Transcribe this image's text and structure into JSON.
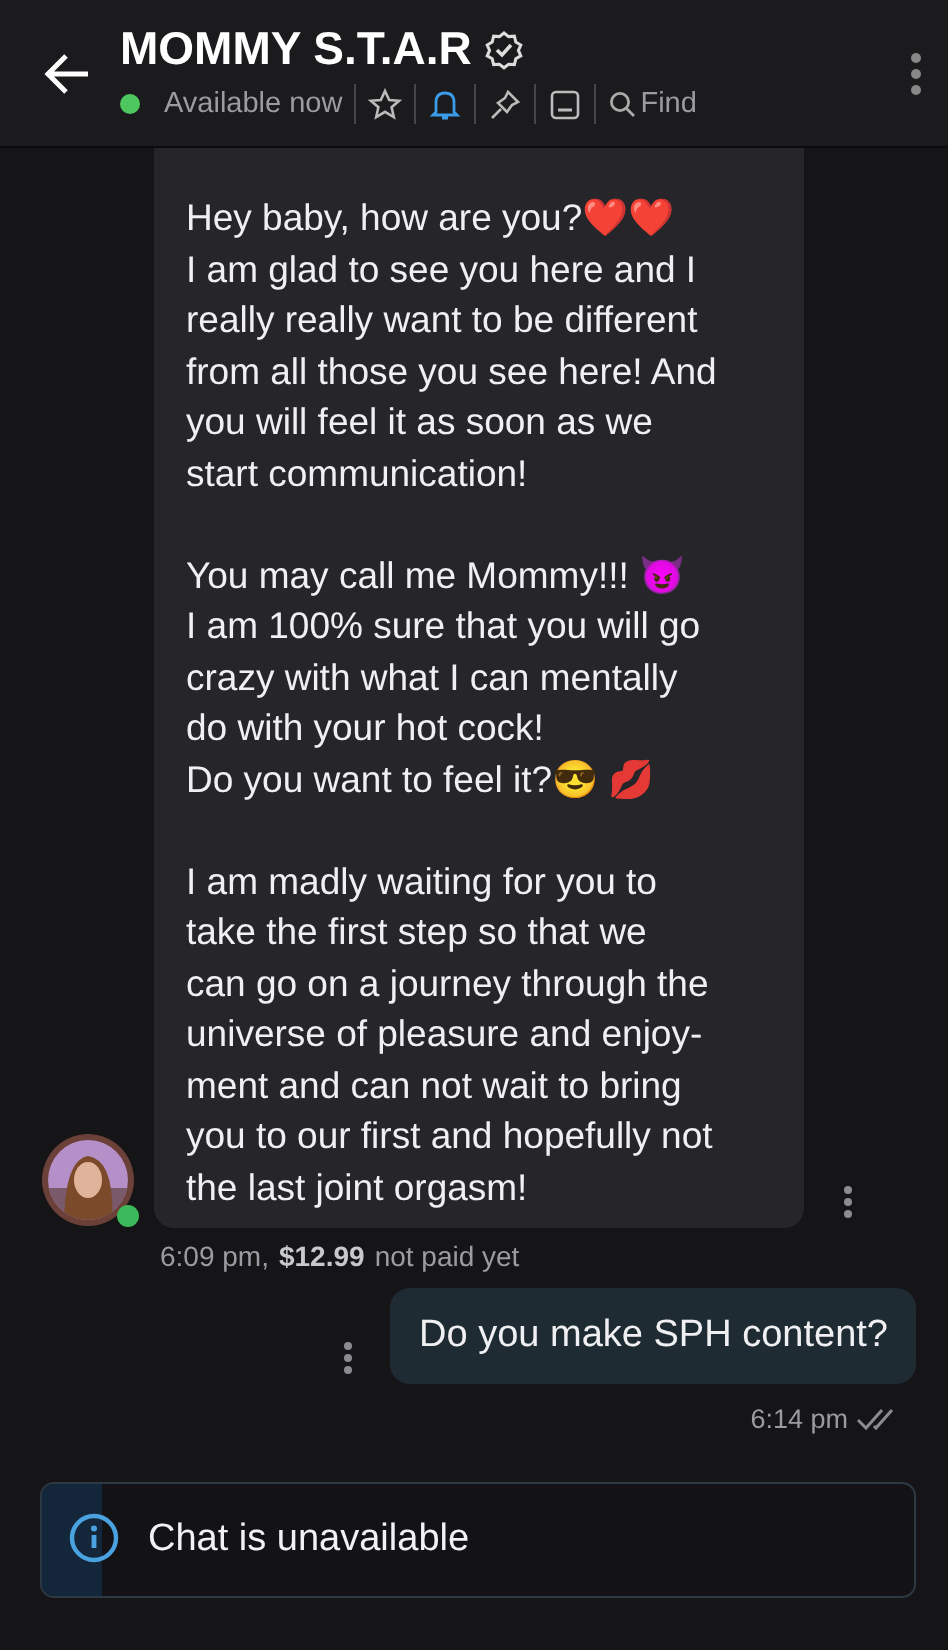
{
  "header": {
    "title": "MOMMY S.T.A.R",
    "verified": true,
    "status": "Available now",
    "online": true,
    "notifications_on": true,
    "find_label": "Find"
  },
  "messages": [
    {
      "kind": "incoming",
      "paragraphs": [
        [
          "Hey baby, how are you?❤️❤️",
          "I am glad to see you here and I",
          "really really want to be different",
          "from all those you see here! And",
          "you will feel it as soon as we",
          "start communication!"
        ],
        [
          "You may call me Mommy!!! 😈",
          "I am 100% sure that you will go",
          "crazy with what I can mentally",
          "do with your hot cock!",
          "Do you want to feel it?😎 💋"
        ],
        [
          "I am madly waiting for you to",
          "take the first step so that we",
          "can go on a journey through the",
          "universe of pleasure and enjoy-",
          "ment and can not wait to bring",
          "you to our first and hopefully not",
          "the last joint orgasm!"
        ]
      ],
      "time": "6:09 pm,",
      "price": "$12.99",
      "payment": "not paid yet"
    },
    {
      "kind": "outgoing",
      "paragraphs": [
        [
          "Do you make SPH content?"
        ]
      ],
      "time": "6:14 pm",
      "read": true
    }
  ],
  "banner": {
    "text": "Chat is unavailable"
  }
}
